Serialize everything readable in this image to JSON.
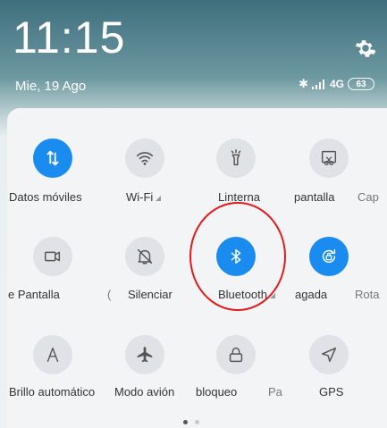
{
  "status": {
    "time": "11:15",
    "date": "Mie, 19 Ago",
    "network": "4G",
    "battery": "63"
  },
  "tiles": [
    {
      "id": "datos",
      "label": "Datos móviles",
      "icon": "arrows-updown-icon",
      "active": true
    },
    {
      "id": "wifi",
      "label": "Wi-Fi",
      "icon": "wifi-icon",
      "active": false
    },
    {
      "id": "linterna",
      "label": "Linterna",
      "icon": "flashlight-icon",
      "active": false
    },
    {
      "id": "pantalla",
      "label": "pantalla",
      "icon": "screenshot-icon",
      "active": false
    },
    {
      "id": "cap",
      "label": "Cap",
      "icon": "",
      "active": false
    },
    {
      "id": "grabar",
      "label": "e Pantalla",
      "icon": "video-icon",
      "active": false
    },
    {
      "id": "paren",
      "label": "(",
      "icon": "",
      "active": false
    },
    {
      "id": "silenciar",
      "label": "Silenciar",
      "icon": "bell-off-icon",
      "active": false
    },
    {
      "id": "bluetooth",
      "label": "Bluetooth",
      "icon": "bluetooth-icon",
      "active": true
    },
    {
      "id": "gagada",
      "label": "agada",
      "icon": "rotate-lock-icon",
      "active": true
    },
    {
      "id": "rota",
      "label": "Rota",
      "icon": "",
      "active": false
    },
    {
      "id": "brillo",
      "label": "Brillo automático",
      "icon": "letter-a-icon",
      "active": false
    },
    {
      "id": "avion",
      "label": "Modo avión",
      "icon": "airplane-icon",
      "active": false
    },
    {
      "id": "bloqueo",
      "label": "bloqueo",
      "icon": "lock-icon",
      "active": false
    },
    {
      "id": "pa",
      "label": "Pa",
      "icon": "",
      "active": false
    },
    {
      "id": "gps",
      "label": "GPS",
      "icon": "location-arrow-icon",
      "active": false
    }
  ],
  "colors": {
    "accent": "#1a8cf0",
    "highlight": "#e21a1a"
  }
}
